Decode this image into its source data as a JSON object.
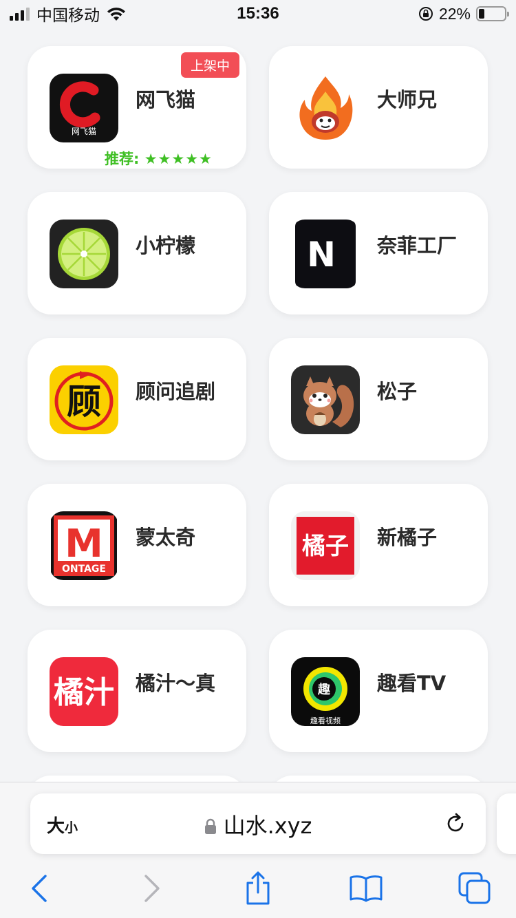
{
  "status_bar": {
    "carrier": "中国移动",
    "time": "15:36",
    "battery_percent": "22%",
    "battery_level": 0.22
  },
  "apps": [
    {
      "name": "网飞猫",
      "icon": "wangfeimao-icon",
      "badge": "上架中",
      "rating_label": "推荐:",
      "rating_stars": "★★★★★",
      "icon_text": "网飞猫"
    },
    {
      "name": "大师兄",
      "icon": "dashixiong-icon"
    },
    {
      "name": "小柠檬",
      "icon": "lemon-icon"
    },
    {
      "name": "奈菲工厂",
      "icon": "naifei-icon",
      "icon_text": "N"
    },
    {
      "name": "顾问追剧",
      "icon": "guwen-icon",
      "icon_text": "顾"
    },
    {
      "name": "松子",
      "icon": "squirrel-icon"
    },
    {
      "name": "蒙太奇",
      "icon": "montage-icon",
      "icon_text": "M",
      "icon_subtext": "ONTAGE"
    },
    {
      "name": "新橘子",
      "icon": "juzi-icon",
      "icon_text": "橘子"
    },
    {
      "name": "橘汁～真",
      "icon": "juzhi-icon",
      "icon_text": "橘汁"
    },
    {
      "name": "趣看TV",
      "icon": "qukan-icon",
      "icon_text": "趣",
      "icon_subtext": "趣看视频"
    }
  ],
  "address_bar": {
    "text_size_big": "大",
    "text_size_small": "小",
    "url": "山水.xyz"
  },
  "toolbar": [
    "back-icon",
    "forward-icon",
    "share-icon",
    "bookmarks-icon",
    "tabs-icon"
  ],
  "colors": {
    "badge": "#f24e56",
    "rating": "#3fbf24",
    "toolbar_blue": "#1a73e8"
  }
}
